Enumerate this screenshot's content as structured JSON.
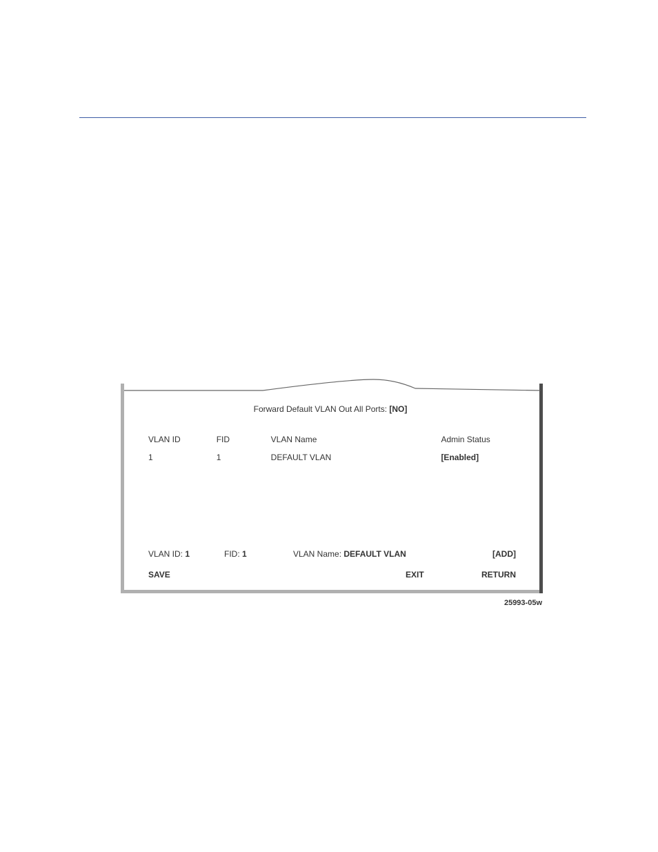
{
  "forward_line": {
    "label": "Forward Default VLAN Out All Ports: ",
    "value": "[NO]"
  },
  "table": {
    "headers": {
      "vlan_id": "VLAN ID",
      "fid": "FID",
      "vlan_name": "VLAN Name",
      "admin_status": "Admin Status"
    },
    "rows": [
      {
        "vlan_id": "1",
        "fid": "1",
        "vlan_name": "DEFAULT VLAN",
        "admin_status": "[Enabled]"
      }
    ]
  },
  "input_row": {
    "vlan_id_label": "VLAN ID: ",
    "vlan_id_value": "1",
    "fid_label": "FID: ",
    "fid_value": "1",
    "vlan_name_label": "VLAN Name: ",
    "vlan_name_value": "DEFAULT VLAN",
    "add": "[ADD]"
  },
  "actions": {
    "save": "SAVE",
    "exit": "EXIT",
    "return": "RETURN"
  },
  "figure_number": "25993-05w"
}
